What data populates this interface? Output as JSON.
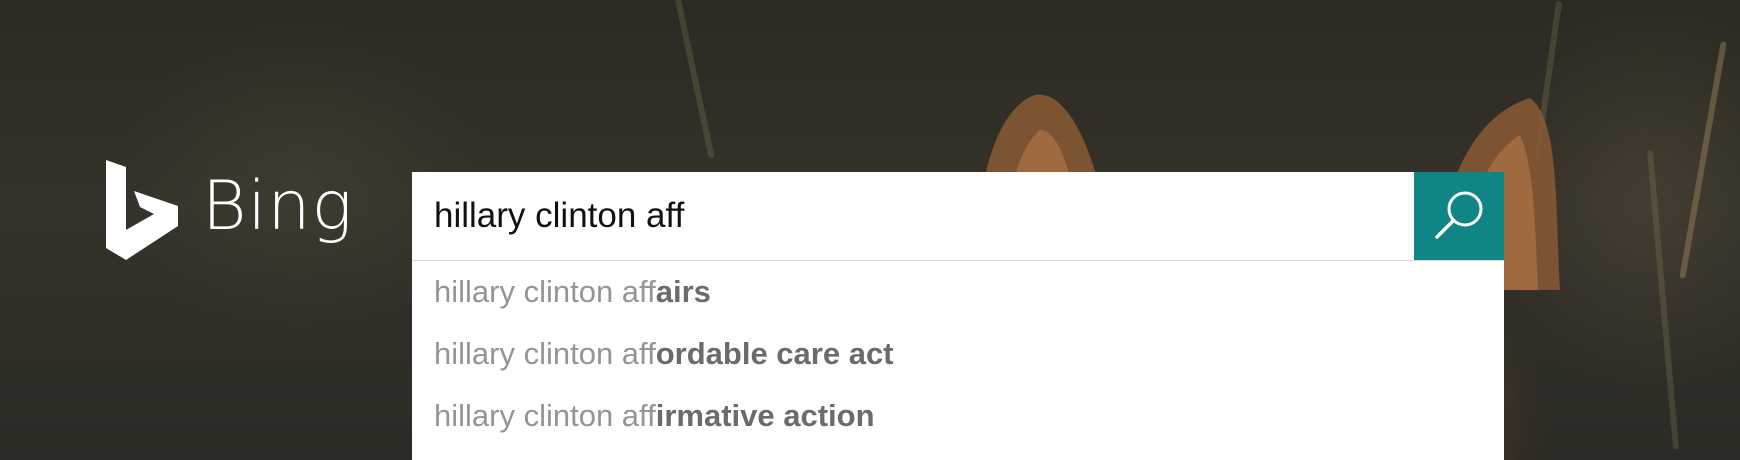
{
  "logo": {
    "text": "Bing"
  },
  "search": {
    "query": "hillary clinton aff"
  },
  "suggestions": [
    {
      "typed": "hillary clinton aff",
      "completion": "airs"
    },
    {
      "typed": "hillary clinton aff",
      "completion": "ordable care act"
    },
    {
      "typed": "hillary clinton aff",
      "completion": "irmative action"
    }
  ],
  "colors": {
    "search_button": "#0f8585",
    "suggestion_typed": "#959595",
    "suggestion_completion": "#6b6b6b"
  },
  "icons": {
    "logo": "bing-logo-icon",
    "search": "magnifier-icon"
  }
}
